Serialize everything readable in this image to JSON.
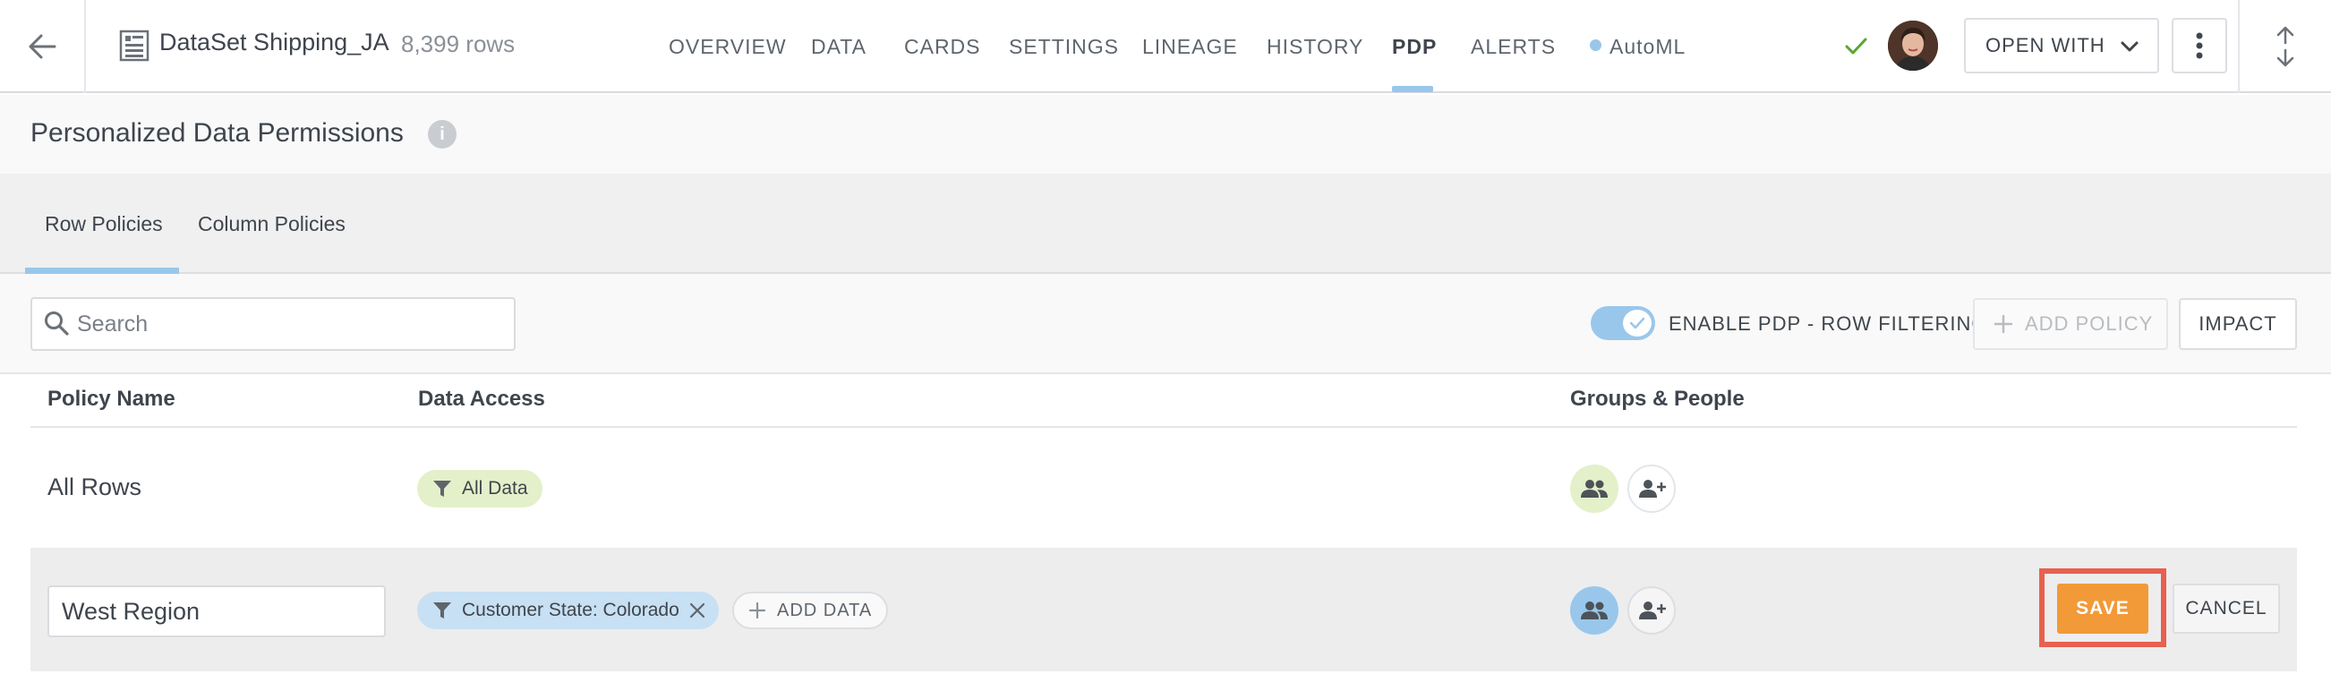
{
  "header": {
    "dataset_name": "DataSet Shipping_JA",
    "row_count": "8,399 rows",
    "nav": [
      "OVERVIEW",
      "DATA",
      "CARDS",
      "SETTINGS",
      "LINEAGE",
      "HISTORY",
      "PDP",
      "ALERTS",
      "AutoML"
    ],
    "active_tab": "PDP",
    "open_with_label": "OPEN WITH"
  },
  "page": {
    "title": "Personalized Data Permissions",
    "info_glyph": "i"
  },
  "subtabs": [
    "Row Policies",
    "Column Policies"
  ],
  "active_subtab": "Row Policies",
  "toolbar": {
    "search_placeholder": "Search",
    "toggle_label": "ENABLE PDP - ROW FILTERING",
    "toggle_on": true,
    "add_policy_label": "ADD POLICY",
    "impact_label": "IMPACT"
  },
  "table": {
    "columns": [
      "Policy Name",
      "Data Access",
      "Groups & People"
    ],
    "rows": [
      {
        "name": "All Rows",
        "filter": "All Data"
      },
      {
        "name": "West Region",
        "filter": "Customer State: Colorado",
        "add_data_label": "ADD DATA",
        "save_label": "SAVE",
        "cancel_label": "CANCEL"
      }
    ]
  },
  "colors": {
    "accent_blue": "#99c7eb",
    "pill_green": "#e3f0c9",
    "pill_blue": "#c8e0f3",
    "save_orange": "#f29a38",
    "highlight_red": "#e8604f",
    "check_green": "#5aa532"
  },
  "icons": [
    "back-arrow-icon",
    "dataset-icon",
    "check-icon",
    "chevron-down-icon",
    "kebab-menu-icon",
    "expand-vertical-icon",
    "info-icon",
    "search-icon",
    "plus-icon",
    "filter-icon",
    "close-icon",
    "group-icon",
    "add-person-icon"
  ]
}
